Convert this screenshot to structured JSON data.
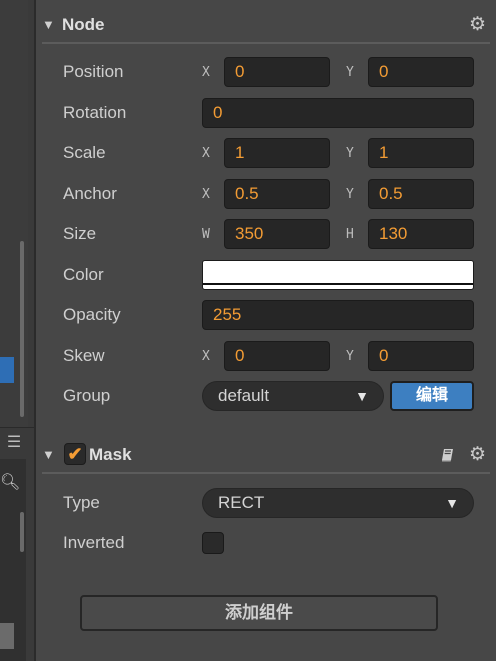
{
  "node": {
    "title": "Node",
    "collapse_glyph": "▼",
    "gear_glyph": "⚙",
    "position": {
      "label": "Position",
      "x_axis": "X",
      "x": "0",
      "y_axis": "Y",
      "y": "0"
    },
    "rotation": {
      "label": "Rotation",
      "value": "0"
    },
    "scale": {
      "label": "Scale",
      "x_axis": "X",
      "x": "1",
      "y_axis": "Y",
      "y": "1"
    },
    "anchor": {
      "label": "Anchor",
      "x_axis": "X",
      "x": "0.5",
      "y_axis": "Y",
      "y": "0.5"
    },
    "size": {
      "label": "Size",
      "w_axis": "W",
      "w": "350",
      "h_axis": "H",
      "h": "130"
    },
    "color": {
      "label": "Color",
      "value": "#ffffff"
    },
    "opacity": {
      "label": "Opacity",
      "value": "255"
    },
    "skew": {
      "label": "Skew",
      "x_axis": "X",
      "x": "0",
      "y_axis": "Y",
      "y": "0"
    },
    "group": {
      "label": "Group",
      "value": "default",
      "caret": "▼",
      "edit_label": "编辑"
    }
  },
  "mask": {
    "title": "Mask",
    "collapse_glyph": "▼",
    "check_glyph": "✔",
    "gear_glyph": "⚙",
    "type": {
      "label": "Type",
      "value": "RECT",
      "caret": "▼"
    },
    "inverted": {
      "label": "Inverted",
      "checked": false
    }
  },
  "add_component_label": "添加组件",
  "left_dock": {
    "menu_glyph": "☰",
    "search_glyph": "🔍︎"
  },
  "colors": {
    "accent": "#f39c34",
    "button_blue": "#3d7fc1",
    "panel_bg": "#474747",
    "field_bg": "#262626"
  }
}
